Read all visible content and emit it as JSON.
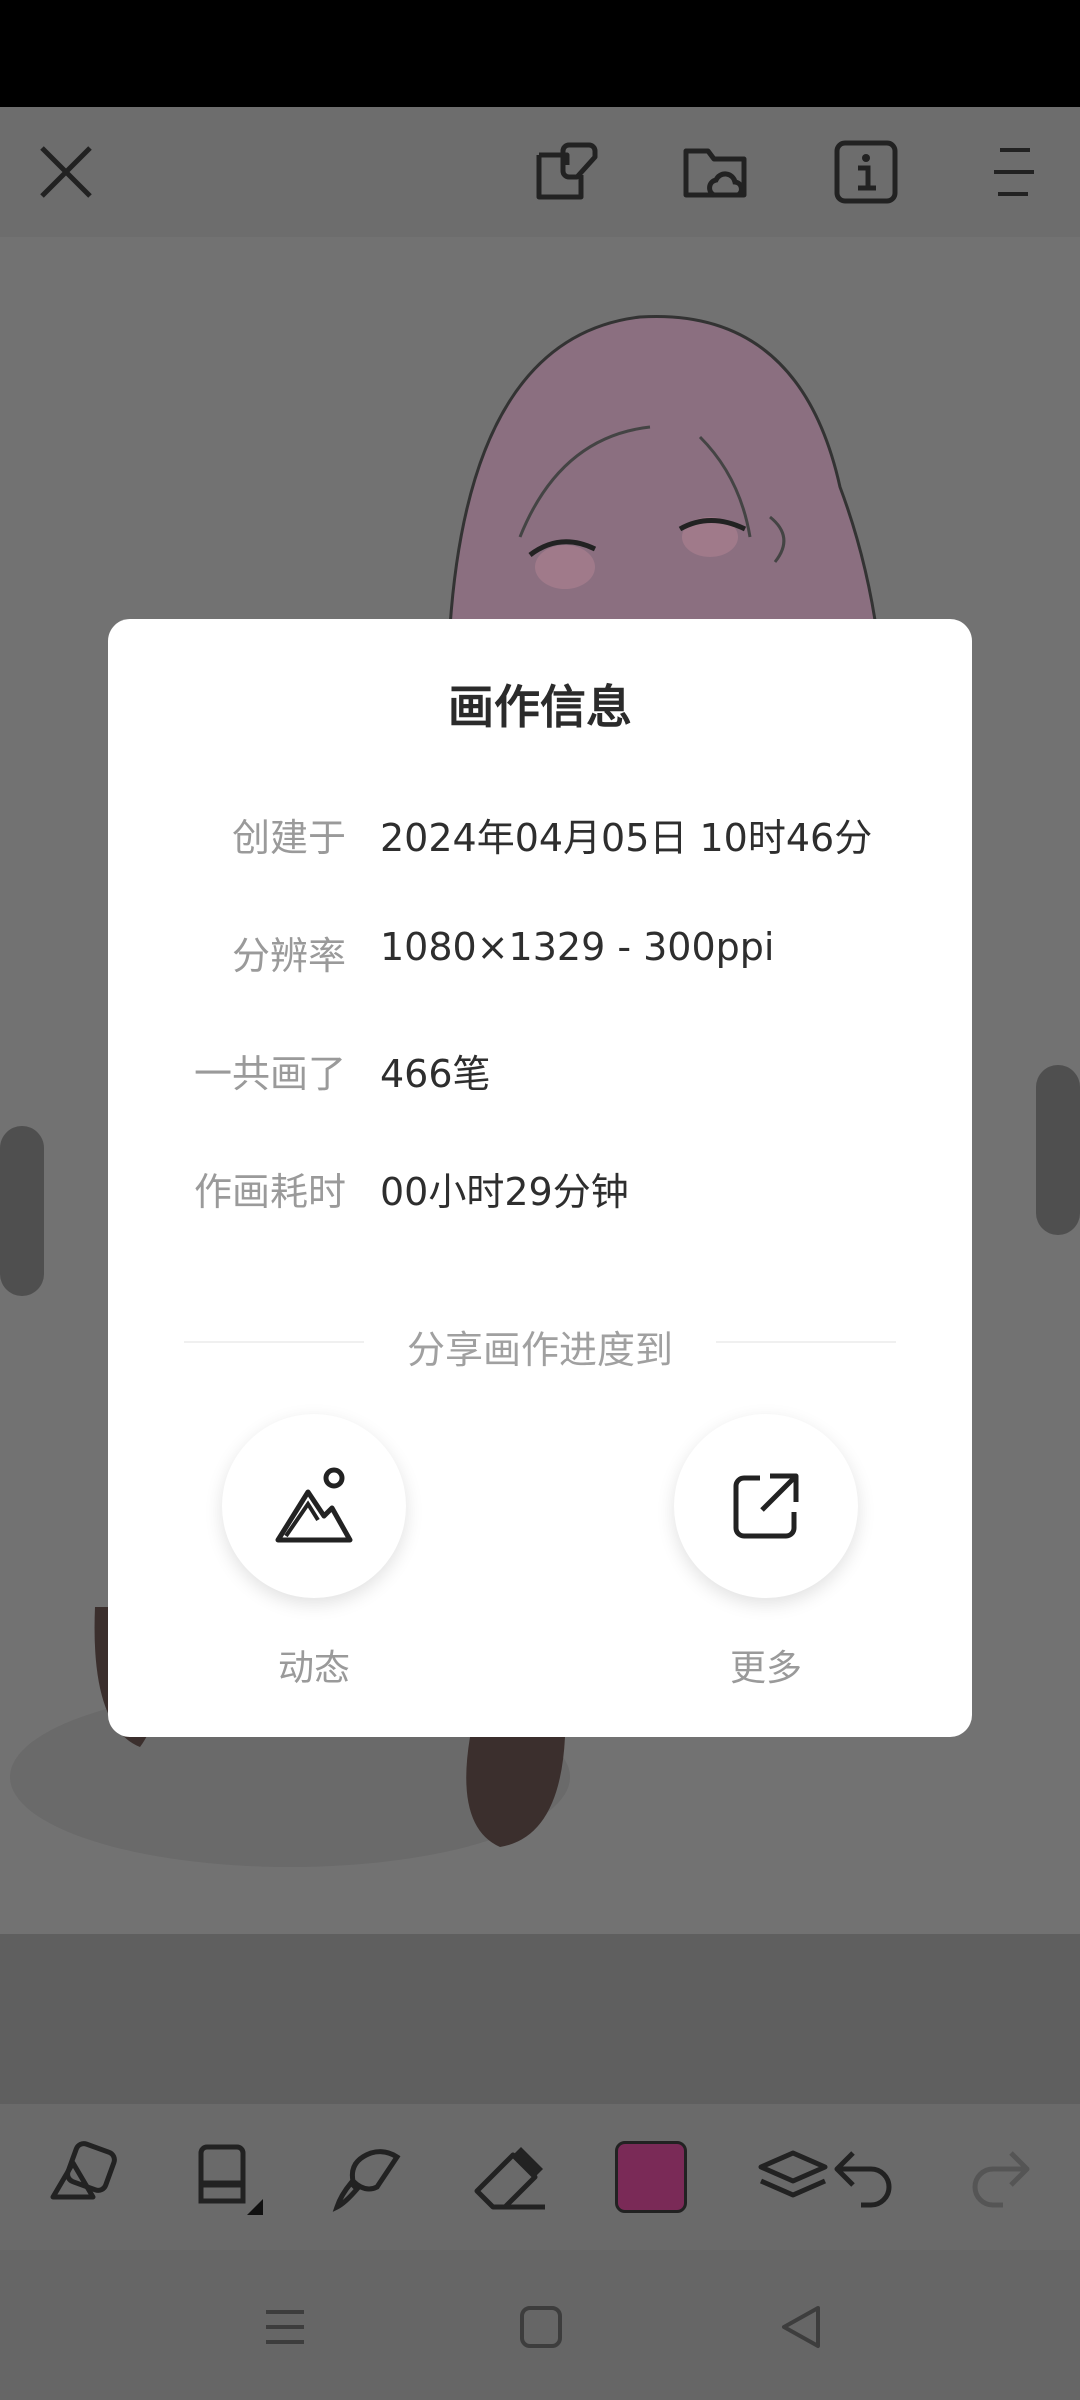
{
  "topbar": {
    "icons": [
      "close-icon",
      "sticker-icon",
      "cloud-folder-icon",
      "info-icon",
      "menu-icon"
    ]
  },
  "dialog": {
    "title": "画作信息",
    "rows": [
      {
        "key": "创建于",
        "value": "2024年04月05日 10时46分"
      },
      {
        "key": "分辨率",
        "value": "1080×1329 - 300ppi"
      },
      {
        "key": "一共画了",
        "value": "466笔"
      },
      {
        "key": "作画耗时",
        "value": "00小时29分钟"
      }
    ],
    "share_title": "分享画作进度到",
    "share": [
      {
        "label": "动态",
        "icon": "mountain-image-icon"
      },
      {
        "label": "更多",
        "icon": "external-share-icon"
      }
    ]
  },
  "toolbar": {
    "icons": [
      "shapes-icon",
      "brush-icon",
      "smudge-icon",
      "eraser-icon",
      "color-swatch",
      "layers-icon",
      "undo-icon",
      "redo-icon"
    ],
    "current_color": "#7a2a57"
  },
  "navbar": {
    "icons": [
      "recent-apps-icon",
      "home-icon",
      "back-icon"
    ]
  }
}
